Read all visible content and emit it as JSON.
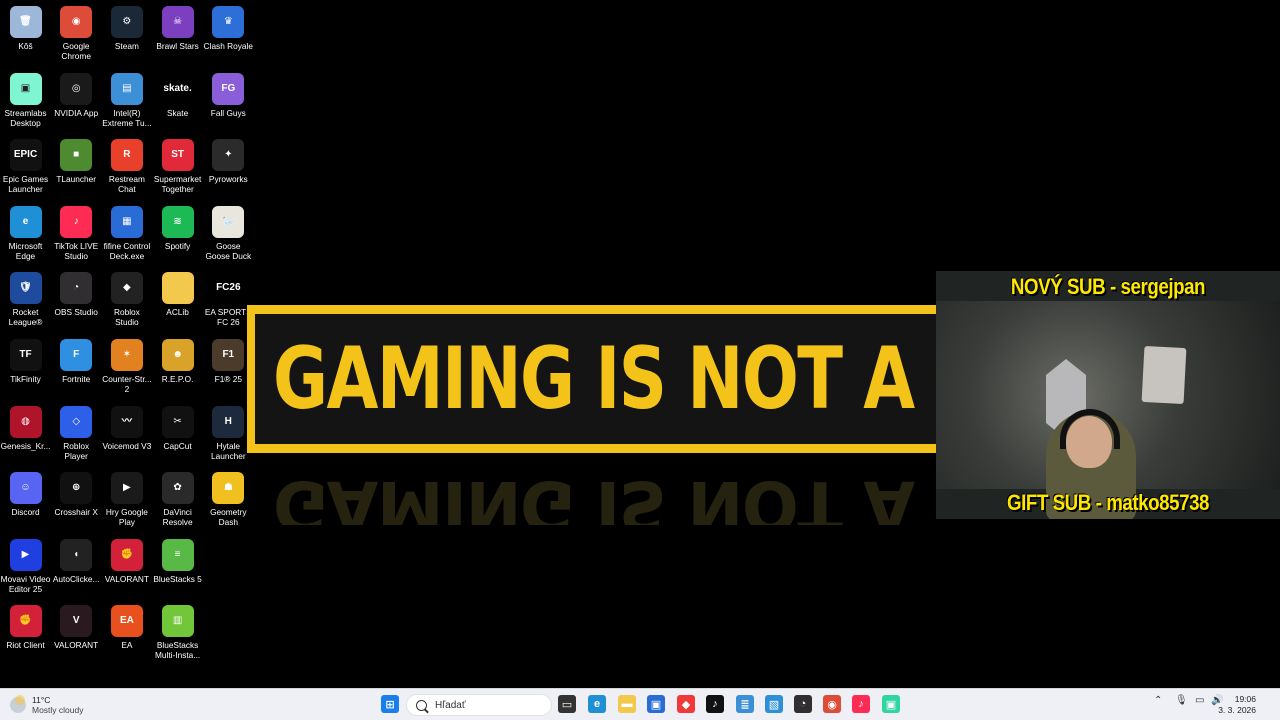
{
  "desktop": {
    "icons": [
      {
        "label": "Kôš",
        "icon": "recycle-bin-icon",
        "bg": "#9cb7d8",
        "glyph": "🗑",
        "col": 0,
        "row": 0
      },
      {
        "label": "Google Chrome",
        "icon": "chrome-icon",
        "bg": "#dd4b39",
        "glyph": "◉",
        "col": 1,
        "row": 0
      },
      {
        "label": "Steam",
        "icon": "steam-icon",
        "bg": "#1b2838",
        "glyph": "⚙",
        "col": 2,
        "row": 0
      },
      {
        "label": "Brawl Stars",
        "icon": "brawl-stars-icon",
        "bg": "#7b3fbf",
        "glyph": "☠",
        "col": 3,
        "row": 0
      },
      {
        "label": "Clash Royale",
        "icon": "clash-royale-icon",
        "bg": "#2d6fd6",
        "glyph": "♛",
        "col": 4,
        "row": 0
      },
      {
        "label": "Streamlabs Desktop",
        "icon": "streamlabs-icon",
        "bg": "#80f5d2",
        "glyph": "▣",
        "col": 0,
        "row": 1
      },
      {
        "label": "NVIDIA App",
        "icon": "nvidia-icon",
        "bg": "#1a1a1a",
        "glyph": "◎",
        "col": 1,
        "row": 1
      },
      {
        "label": "Intel(R) Extreme Tu...",
        "icon": "intel-xtu-icon",
        "bg": "#3d8fd6",
        "glyph": "▤",
        "col": 2,
        "row": 1
      },
      {
        "label": "Skate",
        "icon": "skate-icon",
        "bg": "#000000",
        "glyph": "skate.",
        "col": 3,
        "row": 1
      },
      {
        "label": "Fall Guys",
        "icon": "fall-guys-icon",
        "bg": "#8a5ed8",
        "glyph": "FG",
        "col": 4,
        "row": 1
      },
      {
        "label": "Epic Games Launcher",
        "icon": "epic-games-icon",
        "bg": "#111111",
        "glyph": "EPIC",
        "col": 0,
        "row": 2
      },
      {
        "label": "TLauncher",
        "icon": "tlauncher-icon",
        "bg": "#4e8a2f",
        "glyph": "■",
        "col": 1,
        "row": 2
      },
      {
        "label": "Restream Chat",
        "icon": "restream-icon",
        "bg": "#e8402a",
        "glyph": "R",
        "col": 2,
        "row": 2
      },
      {
        "label": "Supermarket Together",
        "icon": "supermarket-together-icon",
        "bg": "#e02a3a",
        "glyph": "ST",
        "col": 3,
        "row": 2
      },
      {
        "label": "Pyroworks",
        "icon": "pyroworks-icon",
        "bg": "#2b2b2b",
        "glyph": "✦",
        "col": 4,
        "row": 2
      },
      {
        "label": "Microsoft Edge",
        "icon": "edge-icon",
        "bg": "#1f8fd6",
        "glyph": "e",
        "col": 0,
        "row": 3
      },
      {
        "label": "TikTok LIVE Studio",
        "icon": "tiktok-live-icon",
        "bg": "#fe2c55",
        "glyph": "♪",
        "col": 1,
        "row": 3
      },
      {
        "label": "fifine Control Deck.exe",
        "icon": "fifine-icon",
        "bg": "#2a6cd6",
        "glyph": "▦",
        "col": 2,
        "row": 3
      },
      {
        "label": "Spotify",
        "icon": "spotify-icon",
        "bg": "#1db954",
        "glyph": "≋",
        "col": 3,
        "row": 3
      },
      {
        "label": "Goose Goose Duck",
        "icon": "goose-icon",
        "bg": "#e9e6de",
        "glyph": "🦢",
        "col": 4,
        "row": 3
      },
      {
        "label": "Rocket League®",
        "icon": "rocket-league-icon",
        "bg": "#1e4b9e",
        "glyph": "🛡",
        "col": 0,
        "row": 4
      },
      {
        "label": "OBS Studio",
        "icon": "obs-icon",
        "bg": "#302e31",
        "glyph": "◔",
        "col": 1,
        "row": 4
      },
      {
        "label": "Roblox Studio",
        "icon": "roblox-studio-icon",
        "bg": "#222222",
        "glyph": "◆",
        "col": 2,
        "row": 4
      },
      {
        "label": "ACLib",
        "icon": "folder-icon",
        "bg": "#f2c94c",
        "glyph": "",
        "col": 3,
        "row": 4
      },
      {
        "label": "EA SPORTS FC 26",
        "icon": "ea-fc-icon",
        "bg": "#000000",
        "glyph": "FC26",
        "col": 4,
        "row": 4
      },
      {
        "label": "TikFinity",
        "icon": "tikfinity-icon",
        "bg": "#111111",
        "glyph": "TF",
        "col": 0,
        "row": 5
      },
      {
        "label": "Fortnite",
        "icon": "fortnite-icon",
        "bg": "#2f8fe0",
        "glyph": "F",
        "col": 1,
        "row": 5
      },
      {
        "label": "Counter-Str... 2",
        "icon": "counter-strike-icon",
        "bg": "#e2811f",
        "glyph": "✶",
        "col": 2,
        "row": 5
      },
      {
        "label": "R.E.P.O.",
        "icon": "repo-icon",
        "bg": "#d9a32a",
        "glyph": "☻",
        "col": 3,
        "row": 5
      },
      {
        "label": "F1® 25",
        "icon": "f1-icon",
        "bg": "#4b3b2a",
        "glyph": "F1",
        "col": 4,
        "row": 5
      },
      {
        "label": "Genesis_Kr...",
        "icon": "genesis-icon",
        "bg": "#b0142a",
        "glyph": "◍",
        "col": 0,
        "row": 6
      },
      {
        "label": "Roblox Player",
        "icon": "roblox-player-icon",
        "bg": "#2d5fe8",
        "glyph": "◇",
        "col": 1,
        "row": 6
      },
      {
        "label": "Voicemod V3",
        "icon": "voicemod-icon",
        "bg": "#111111",
        "glyph": "〰",
        "col": 2,
        "row": 6
      },
      {
        "label": "CapCut",
        "icon": "capcut-icon",
        "bg": "#111111",
        "glyph": "✂",
        "col": 3,
        "row": 6
      },
      {
        "label": "Hytale Launcher",
        "icon": "hytale-icon",
        "bg": "#1d2a3e",
        "glyph": "H",
        "col": 4,
        "row": 6
      },
      {
        "label": "Discord",
        "icon": "discord-icon",
        "bg": "#5865f2",
        "glyph": "☺",
        "col": 0,
        "row": 7
      },
      {
        "label": "Crosshair X",
        "icon": "crosshair-icon",
        "bg": "#111111",
        "glyph": "⊕",
        "col": 1,
        "row": 7
      },
      {
        "label": "Hry Google Play",
        "icon": "google-play-games-icon",
        "bg": "#1a1a1a",
        "glyph": "▶",
        "col": 2,
        "row": 7
      },
      {
        "label": "DaVinci Resolve",
        "icon": "davinci-icon",
        "bg": "#2a2a2a",
        "glyph": "✿",
        "col": 3,
        "row": 7
      },
      {
        "label": "Geometry Dash",
        "icon": "geometry-dash-icon",
        "bg": "#f0c020",
        "glyph": "☗",
        "col": 4,
        "row": 7
      },
      {
        "label": "Movavi Video Editor 25",
        "icon": "movavi-icon",
        "bg": "#1f3fe0",
        "glyph": "▶",
        "col": 0,
        "row": 8
      },
      {
        "label": "AutoClicke...",
        "icon": "mouse-icon",
        "bg": "#222222",
        "glyph": "◖",
        "col": 1,
        "row": 8
      },
      {
        "label": "VALORANT",
        "icon": "riot-icon",
        "bg": "#d3213a",
        "glyph": "✊",
        "col": 2,
        "row": 8
      },
      {
        "label": "BlueStacks 5",
        "icon": "bluestacks-icon",
        "bg": "#59b947",
        "glyph": "≡",
        "col": 3,
        "row": 8
      },
      {
        "label": "Riot Client",
        "icon": "riot-client-icon",
        "bg": "#d3213a",
        "glyph": "✊",
        "col": 0,
        "row": 9
      },
      {
        "label": "VALORANT",
        "icon": "valorant-icon",
        "bg": "#2a1a20",
        "glyph": "V",
        "col": 1,
        "row": 9
      },
      {
        "label": "EA",
        "icon": "ea-icon",
        "bg": "#e8501e",
        "glyph": "EA",
        "col": 2,
        "row": 9
      },
      {
        "label": "BlueStacks Multi-Insta...",
        "icon": "bluestacks-multi-icon",
        "bg": "#72c63a",
        "glyph": "▥",
        "col": 3,
        "row": 9
      }
    ]
  },
  "banner": {
    "text": "GAMING IS NOT A CRI"
  },
  "overlay": {
    "top_caption": "NOVÝ SUB - sergejpan",
    "bottom_caption": "GIFT SUB - matko85738"
  },
  "taskbar": {
    "weather_temp": "11°C",
    "weather_desc": "Mostly cloudy",
    "search_placeholder": "Hľadať",
    "time": "19:06",
    "date": "3. 3. 2026",
    "pinned": [
      {
        "icon": "windows-start-icon",
        "bg": "#1a7fe8",
        "glyph": "⊞"
      },
      {
        "icon": "task-view-icon",
        "bg": "#333333",
        "glyph": "▭"
      },
      {
        "icon": "edge-icon",
        "bg": "#1f8fd6",
        "glyph": "e"
      },
      {
        "icon": "file-explorer-icon",
        "bg": "#f2c94c",
        "glyph": "▬"
      },
      {
        "icon": "store-icon",
        "bg": "#2a6cd6",
        "glyph": "▣"
      },
      {
        "icon": "diamond-app-icon",
        "bg": "#f03a3a",
        "glyph": "◆"
      },
      {
        "icon": "tiktok-icon",
        "bg": "#111111",
        "glyph": "♪"
      },
      {
        "icon": "notepad-icon",
        "bg": "#3c8fd6",
        "glyph": "≣"
      },
      {
        "icon": "photos-icon",
        "bg": "#2d8fd6",
        "glyph": "▧"
      },
      {
        "icon": "obs-icon",
        "bg": "#302e31",
        "glyph": "◔"
      },
      {
        "icon": "chrome-icon",
        "bg": "#dd4b39",
        "glyph": "◉"
      },
      {
        "icon": "tiktok-live-icon",
        "bg": "#fe2c55",
        "glyph": "♪"
      },
      {
        "icon": "streamlabs-icon",
        "bg": "#2fd6a0",
        "glyph": "▣"
      }
    ]
  }
}
